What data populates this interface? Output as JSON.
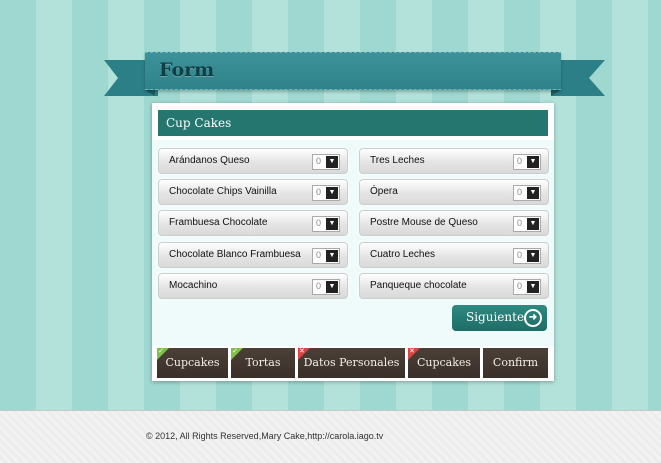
{
  "header": {
    "title": "Form"
  },
  "section": {
    "title": "Cup Cakes"
  },
  "items_left": [
    {
      "label": "Arándanos Queso",
      "qty": "0"
    },
    {
      "label": "Chocolate Chips Vainilla",
      "qty": "0"
    },
    {
      "label": "Frambuesa Chocolate",
      "qty": "0"
    },
    {
      "label": "Chocolate Blanco Frambuesa",
      "qty": "0"
    },
    {
      "label": "Mocachino",
      "qty": "0"
    }
  ],
  "items_right": [
    {
      "label": "Tres Leches",
      "qty": "0"
    },
    {
      "label": "Ópera",
      "qty": "0"
    },
    {
      "label": "Postre Mouse de Queso",
      "qty": "0"
    },
    {
      "label": "Cuatro Leches",
      "qty": "0"
    },
    {
      "label": "Panqueque chocolate",
      "qty": "0"
    }
  ],
  "next_button": {
    "label": "Siguiente",
    "icon": "arrow-circle-right-icon"
  },
  "tabs": [
    {
      "label": "Cupcakes",
      "status": "complete"
    },
    {
      "label": "Tortas",
      "status": "complete"
    },
    {
      "label": "Datos Personales",
      "status": "incomplete"
    },
    {
      "label": "Cupcakes",
      "status": "incomplete"
    },
    {
      "label": "Confirm",
      "status": "none"
    }
  ],
  "colors": {
    "accent": "#24766f",
    "ribbon": "#2f828a",
    "tab_bg": "#3e342d",
    "ok": "#7fc24a",
    "error": "#d94444"
  },
  "footer": {
    "text": "© 2012, All Rights Reserved,Mary Cake,http://carola.iago.tv"
  }
}
